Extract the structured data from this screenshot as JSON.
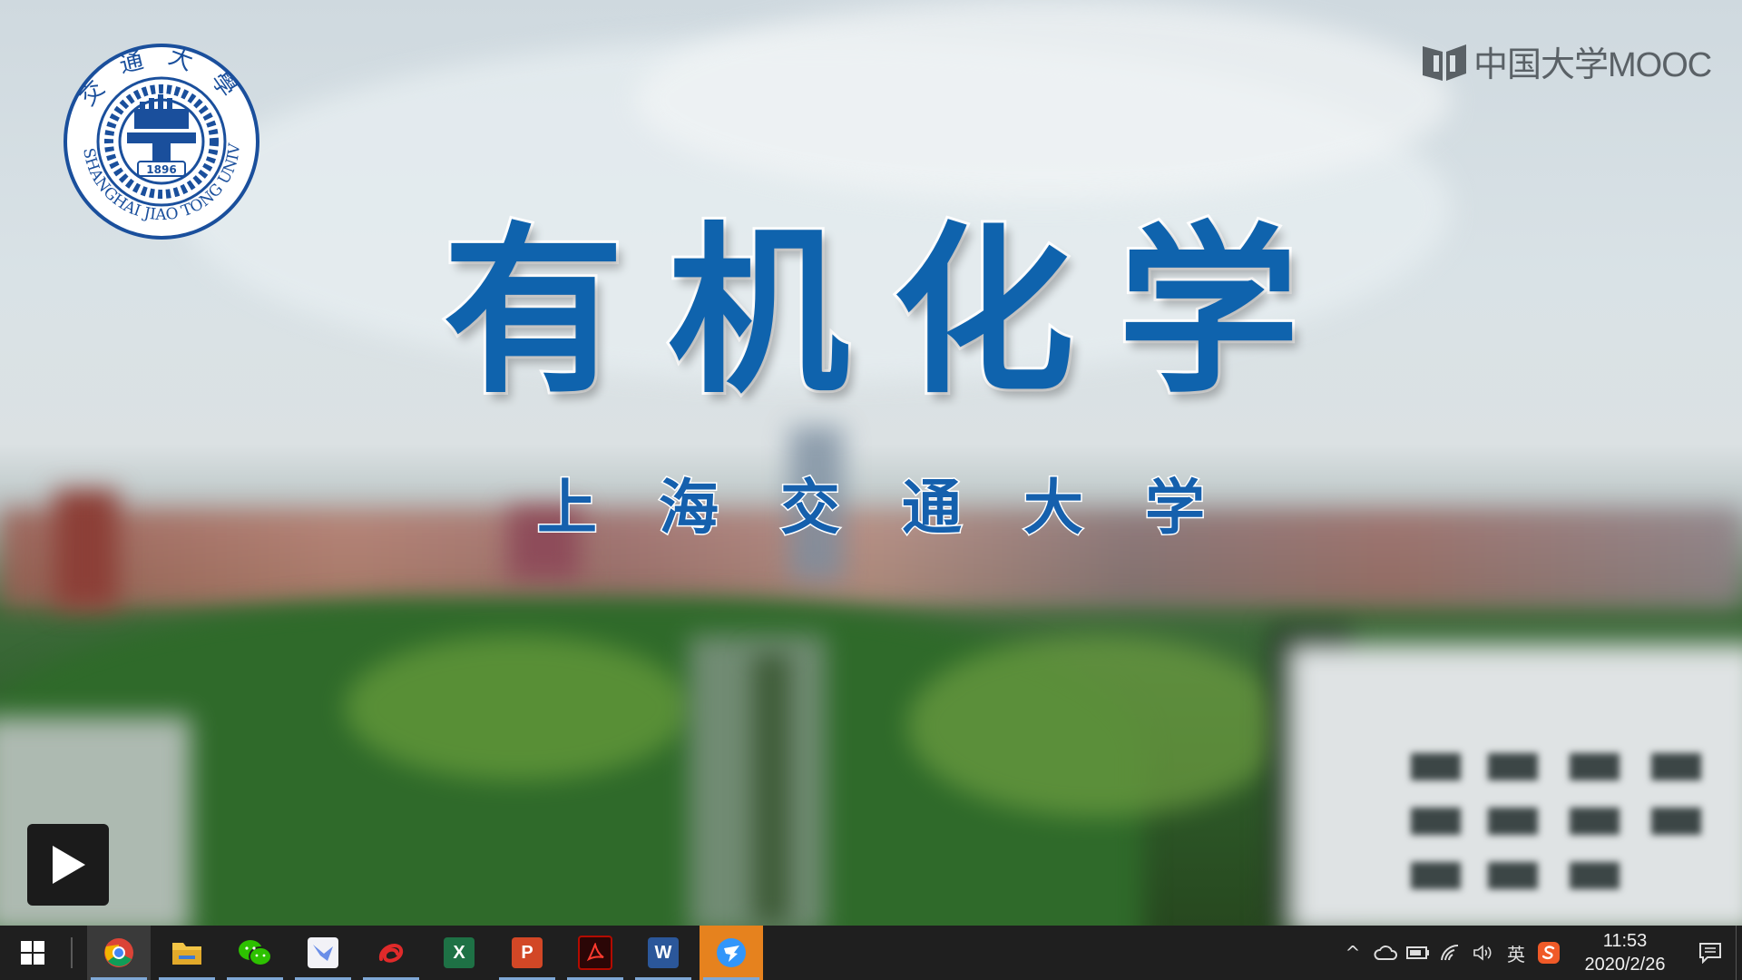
{
  "video": {
    "course_title": "有机化学",
    "university_title": "上海交通大学",
    "mooc_logo_text": "中国大学MOOC",
    "seal": {
      "ring_text": "SHANGHAI JIAO TONG UNIVERSITY",
      "top_text": "交通大學",
      "year": "1896"
    },
    "play_icon": "play-icon"
  },
  "taskbar": {
    "start_icon": "windows-logo-icon",
    "apps": [
      {
        "name": "chrome",
        "icon": "chrome-icon",
        "glyph": "",
        "color": "#db4437"
      },
      {
        "name": "file-explorer",
        "icon": "folder-icon",
        "glyph": "",
        "color": "#f3c546"
      },
      {
        "name": "wechat",
        "icon": "wechat-icon",
        "glyph": "",
        "color": "#2dc100"
      },
      {
        "name": "feishu",
        "icon": "bird-icon",
        "glyph": "",
        "color": "#6a8ee8"
      },
      {
        "name": "scribble-app",
        "icon": "scribble-icon",
        "glyph": "",
        "color": "#e02a2a"
      },
      {
        "name": "excel",
        "icon": "excel-icon",
        "glyph": "X",
        "color": "#1e7145"
      },
      {
        "name": "powerpoint",
        "icon": "powerpoint-icon",
        "glyph": "P",
        "color": "#d24726"
      },
      {
        "name": "pdf-reader",
        "icon": "pdf-icon",
        "glyph": "",
        "color": "#b30b00"
      },
      {
        "name": "word",
        "icon": "word-icon",
        "glyph": "W",
        "color": "#2b579a"
      },
      {
        "name": "dingtalk",
        "icon": "dingtalk-icon",
        "glyph": "",
        "color": "#3296fa"
      }
    ],
    "tray": {
      "chevron": "^",
      "ime_label": "英",
      "time": "11:53",
      "date": "2020/2/26"
    }
  }
}
